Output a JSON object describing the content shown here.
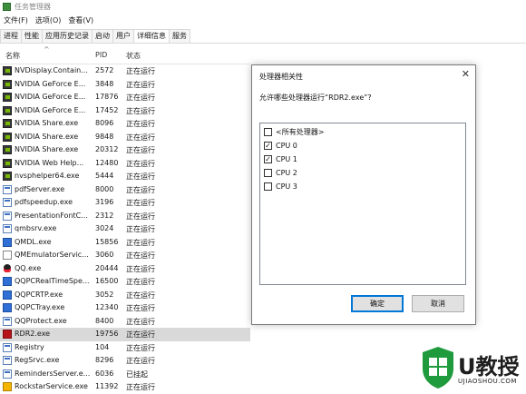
{
  "window": {
    "title": "任务管理器"
  },
  "menu": [
    "文件(F)",
    "选项(O)",
    "查看(V)"
  ],
  "tabs": [
    {
      "label": "进程",
      "active": false
    },
    {
      "label": "性能",
      "active": false
    },
    {
      "label": "应用历史记录",
      "active": false
    },
    {
      "label": "启动",
      "active": false
    },
    {
      "label": "用户",
      "active": false
    },
    {
      "label": "详细信息",
      "active": true
    },
    {
      "label": "服务",
      "active": false
    }
  ],
  "table": {
    "headers": {
      "name": "名称",
      "pid": "PID",
      "status": "状态"
    },
    "rows": [
      {
        "icon": "nvidia-icon",
        "name": "NVDisplay.Contain...",
        "pid": "2572",
        "status": "正在运行"
      },
      {
        "icon": "nvidia-icon",
        "name": "NVIDIA GeForce E...",
        "pid": "3848",
        "status": "正在运行"
      },
      {
        "icon": "nvidia-icon",
        "name": "NVIDIA GeForce E...",
        "pid": "17876",
        "status": "正在运行"
      },
      {
        "icon": "nvidia-icon",
        "name": "NVIDIA GeForce E...",
        "pid": "17452",
        "status": "正在运行"
      },
      {
        "icon": "nvidia-icon",
        "name": "NVIDIA Share.exe",
        "pid": "8096",
        "status": "正在运行"
      },
      {
        "icon": "nvidia-icon",
        "name": "NVIDIA Share.exe",
        "pid": "9848",
        "status": "正在运行"
      },
      {
        "icon": "nvidia-icon",
        "name": "NVIDIA Share.exe",
        "pid": "20312",
        "status": "正在运行"
      },
      {
        "icon": "nvidia-icon",
        "name": "NVIDIA Web Help...",
        "pid": "12480",
        "status": "正在运行"
      },
      {
        "icon": "nvidia-icon",
        "name": "nvsphelper64.exe",
        "pid": "5444",
        "status": "正在运行"
      },
      {
        "icon": "window-icon",
        "name": "pdfServer.exe",
        "pid": "8000",
        "status": "正在运行"
      },
      {
        "icon": "window-icon",
        "name": "pdfspeedup.exe",
        "pid": "3196",
        "status": "正在运行"
      },
      {
        "icon": "window-icon",
        "name": "PresentationFontC...",
        "pid": "2312",
        "status": "正在运行"
      },
      {
        "icon": "window-icon",
        "name": "qmbsrv.exe",
        "pid": "3024",
        "status": "正在运行"
      },
      {
        "icon": "blue-app-icon",
        "name": "QMDL.exe",
        "pid": "15856",
        "status": "正在运行"
      },
      {
        "icon": "terminal-icon",
        "name": "QMEmulatorServic...",
        "pid": "3060",
        "status": "正在运行"
      },
      {
        "icon": "qq-penguin-icon",
        "name": "QQ.exe",
        "pid": "20444",
        "status": "正在运行"
      },
      {
        "icon": "blue-app-icon",
        "name": "QQPCRealTimeSpe...",
        "pid": "16500",
        "status": "正在运行"
      },
      {
        "icon": "blue-app-icon",
        "name": "QQPCRTP.exe",
        "pid": "3052",
        "status": "正在运行"
      },
      {
        "icon": "blue-app-icon",
        "name": "QQPCTray.exe",
        "pid": "12340",
        "status": "正在运行"
      },
      {
        "icon": "window-icon",
        "name": "QQProtect.exe",
        "pid": "8400",
        "status": "正在运行"
      },
      {
        "icon": "rdr2-icon",
        "name": "RDR2.exe",
        "pid": "19756",
        "status": "正在运行",
        "selected": true
      },
      {
        "icon": "window-icon",
        "name": "Registry",
        "pid": "104",
        "status": "正在运行"
      },
      {
        "icon": "window-icon",
        "name": "RegSrvc.exe",
        "pid": "8296",
        "status": "正在运行"
      },
      {
        "icon": "window-icon",
        "name": "RemindersServer.e...",
        "pid": "6036",
        "status": "已挂起"
      },
      {
        "icon": "rockstar-icon",
        "name": "RockstarService.exe",
        "pid": "11392",
        "status": "正在运行"
      }
    ]
  },
  "dialog": {
    "title": "处理器相关性",
    "close": "✕",
    "prompt": "允许哪些处理器运行“RDR2.exe”?",
    "items": [
      {
        "label": "<所有处理器>",
        "checked": false
      },
      {
        "label": "CPU 0",
        "checked": true
      },
      {
        "label": "CPU 1",
        "checked": true
      },
      {
        "label": "CPU 2",
        "checked": false
      },
      {
        "label": "CPU 3",
        "checked": false
      }
    ],
    "ok": "确定",
    "cancel": "取消"
  },
  "watermark": {
    "brand": "U教授",
    "url": "UJIAOSHOU.COM"
  }
}
